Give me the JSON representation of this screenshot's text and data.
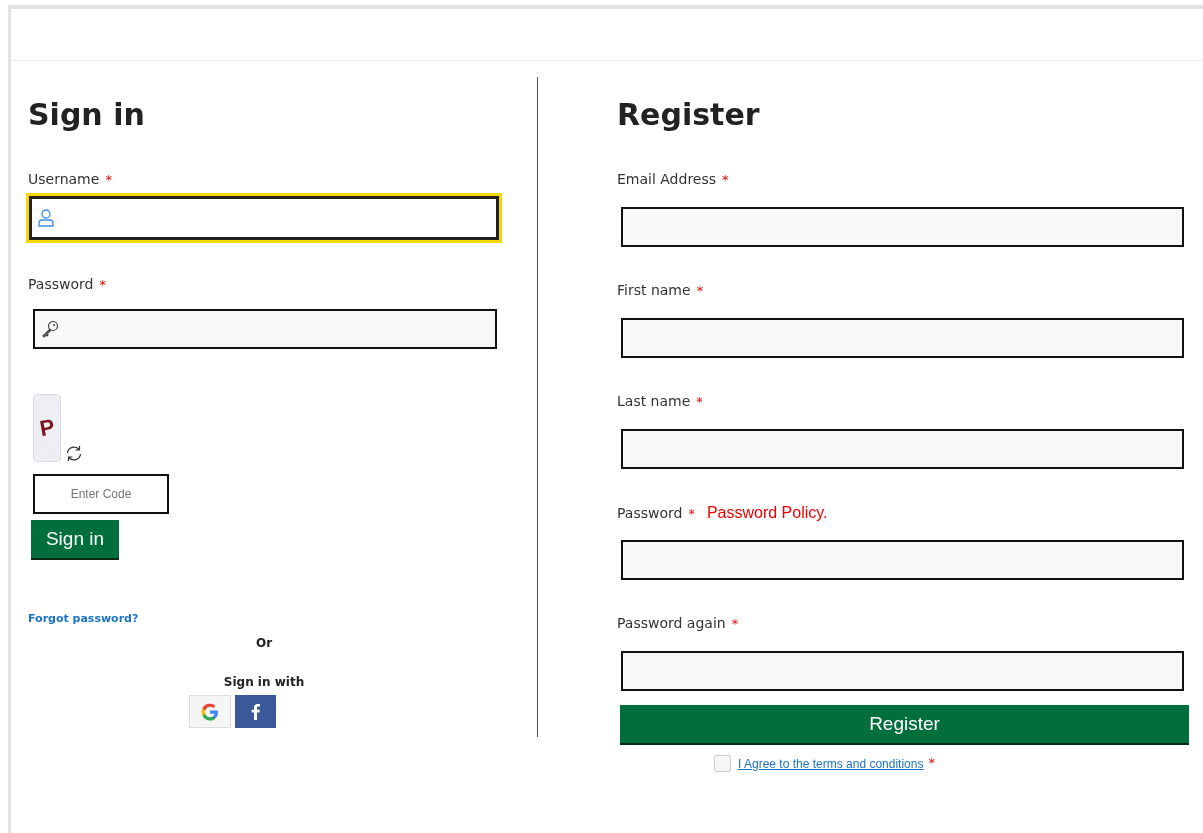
{
  "sign_in": {
    "title": "Sign in",
    "fields": [
      {
        "label": "Username",
        "required_mark": "*",
        "kind": "user",
        "focused": true
      },
      {
        "label": "Password",
        "required_mark": "*",
        "kind": "key",
        "focused": false
      }
    ],
    "captcha": {
      "code": "P",
      "placeholder": "Enter Code"
    },
    "button": "Sign in",
    "forgot_link": "Forgot password?",
    "separator": "Or",
    "social_heading": "Sign in with",
    "social_buttons": [
      {
        "kind": "google"
      },
      {
        "kind": "facebook"
      }
    ]
  },
  "register": {
    "title": "Register",
    "fields": [
      {
        "label": "Email Address",
        "required_mark": "*"
      },
      {
        "label": "First name",
        "required_mark": "*"
      },
      {
        "label": "Last name",
        "required_mark": "*"
      },
      {
        "label": "Password",
        "required_mark": "*",
        "note": "Password Policy."
      },
      {
        "label": "Password again",
        "required_mark": "*"
      }
    ],
    "button": "Register",
    "terms": {
      "checked": false,
      "link": "I Agree to the terms and conditions",
      "required_mark": "*"
    }
  }
}
